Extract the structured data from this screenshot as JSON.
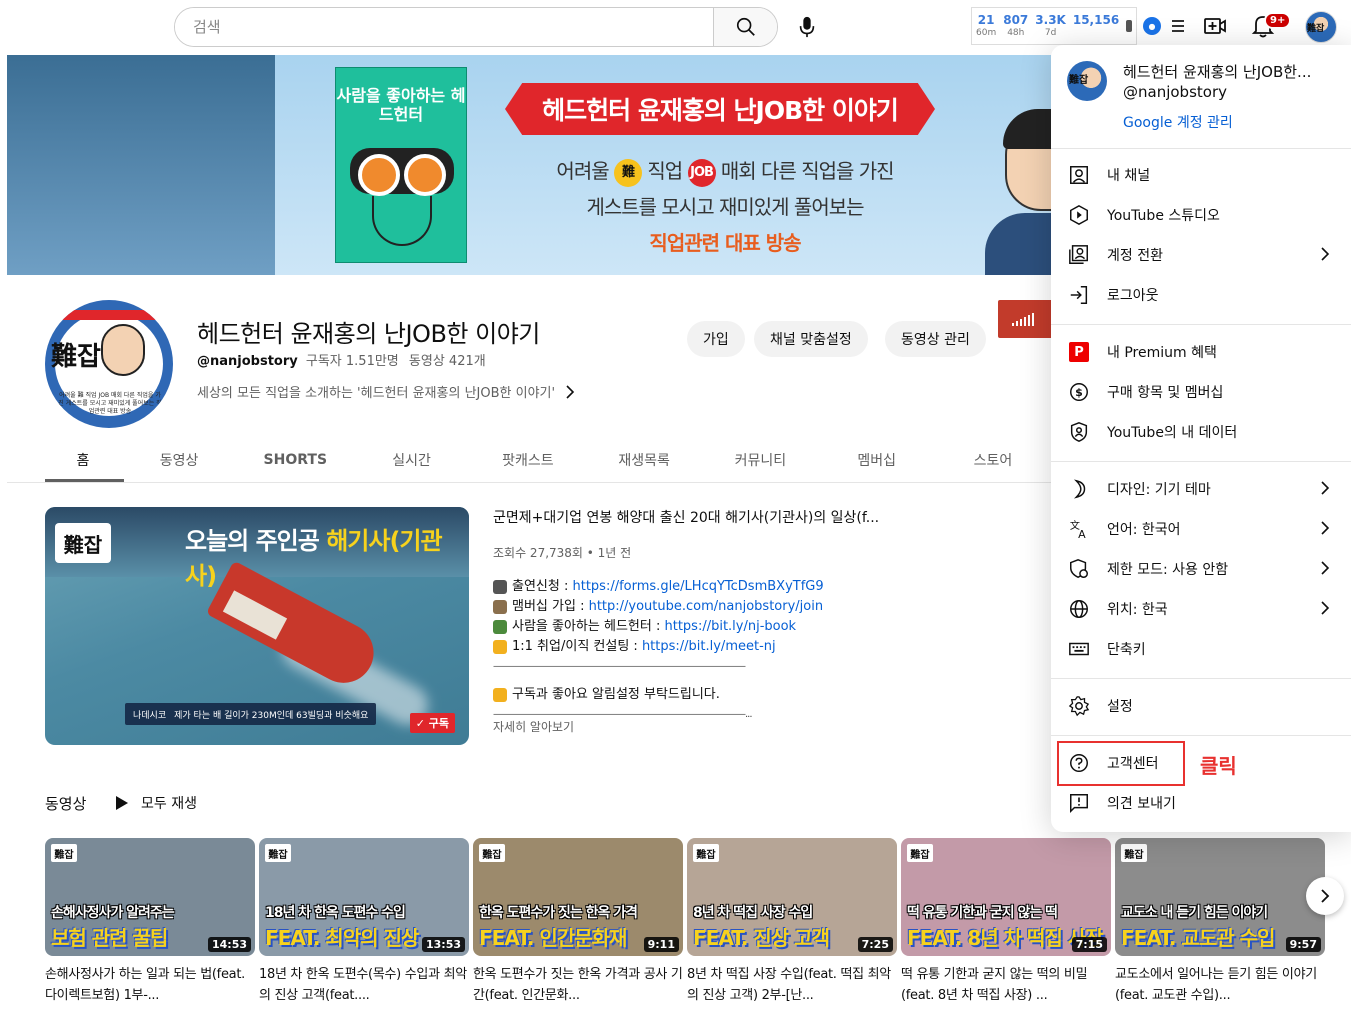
{
  "topbar": {
    "search_placeholder": "검색",
    "stats": [
      {
        "value": "21",
        "label": "60m"
      },
      {
        "value": "807",
        "label": "48h"
      },
      {
        "value": "3.3K",
        "label": "7d"
      },
      {
        "value": "15,156",
        "label": ""
      }
    ],
    "notif_badge": "9+",
    "avatar_text": "難잡"
  },
  "banner": {
    "book_title": "사람을 좋아하는 헤드헌터",
    "headline": "헤드헌터 윤재홍의 난JOB한 이야기",
    "line1_a": "어려울",
    "line1_b": "직업",
    "line1_c": "매회 다른 직업을 가진",
    "circle1": "難",
    "circle2": "JOB",
    "line2": "게스트를 모시고 재미있게 풀어보는",
    "line3": "직업관련 대표 방송"
  },
  "channel": {
    "avatar_big": "難잡",
    "avatar_small": "어려울 難 직업 JOB 매회 다른 직업을 가진 게스트를 모시고 재미있게 풀어보는 직업관련 대표 방송",
    "title": "헤드헌터 윤재홍의 난JOB한 이야기",
    "handle": "@nanjobstory",
    "subs": "구독자 1.51만명",
    "videos": "동영상 421개",
    "description": "세상의 모든 직업을 소개하는 '헤드헌터 윤재홍의 난JOB한 이야기'",
    "btn_join": "가입",
    "btn_customize": "채널 맞춤설정",
    "btn_manage": "동영상 관리"
  },
  "tabs": [
    "홈",
    "동영상",
    "SHORTS",
    "실시간",
    "팟캐스트",
    "재생목록",
    "커뮤니티",
    "멤버십",
    "스토어"
  ],
  "featured": {
    "thumb_logo": "難잡",
    "thumb_title_a": "오늘의 주인공",
    "thumb_title_b": "해기사(기관사)",
    "thumb_caption_a": "나데시코",
    "thumb_caption_b": "제가 타는 배 길이가 230M인데 63빌딩과 비슷해요",
    "thumb_subscribe": "구독",
    "title": "군면제+대기업 연봉 해양대 출신 20대 해기사(기관사)의 일상(f...",
    "meta": "조회수 27,738회 • 1년 전",
    "lines": [
      {
        "text": "출연신청 : ",
        "link": "https://forms.gle/LHcqYTcDsmBXyTfG9",
        "color": "#555555"
      },
      {
        "text": "맴버십 가입 : ",
        "link": "http://youtube.com/nanjobstory/join",
        "color": "#8a6f4d"
      },
      {
        "text": "사람을 좋아하는 헤드헌터 : ",
        "link": "https://bit.ly/nj-book",
        "color": "#4c8a3c"
      },
      {
        "text": "1:1 취업/이직 컨설팅 : ",
        "link": "https://bit.ly/meet-nj",
        "color": "#f2b01e"
      }
    ],
    "rule1": "————————————————————————————",
    "cta": "구독과 좋아요 알림설정 부탁드립니다.",
    "rule2": "————————————————————————————...",
    "more": "자세히 알아보기"
  },
  "shelf": {
    "title": "동영상",
    "play_all": "모두 재생",
    "videos": [
      {
        "t1": "손해사정사가 알려주는",
        "t2": "보험 관련 꿀팁",
        "dur": "14:53",
        "title": "손해사정사가 하는 일과 되는 법(feat. 다이렉트보험) 1부-...",
        "bg": "#7a8a97"
      },
      {
        "t1": "18년 차 한옥 도편수 수입",
        "t2": "FEAT. 최악의 진상",
        "dur": "13:53",
        "title": "18년 차 한옥 도편수(목수) 수입과 최악의 진상 고객(feat....",
        "bg": "#8a9aa8"
      },
      {
        "t1": "한옥 도편수가 짓는 한옥 가격",
        "t2": "FEAT. 인간문화재",
        "dur": "9:11",
        "title": "한옥 도편수가 짓는 한옥 가격과 공사 기간(feat. 인간문화...",
        "bg": "#9c8a6c"
      },
      {
        "t1": "8년 차 떡집 사장 수입",
        "t2": "FEAT. 진상 고객",
        "dur": "7:25",
        "title": "8년 차 떡집 사장 수입(feat. 떡집 최악의 진상 고객) 2부-[난...",
        "bg": "#b6a596"
      },
      {
        "t1": "떡 유통 기한과 굳지 않는 떡",
        "t2": "FEAT. 8년 차 떡집 사장",
        "dur": "7:15",
        "title": "떡 유통 기한과 굳지 않는 떡의 비밀(feat. 8년 차 떡집 사장) ...",
        "bg": "#c39aa8"
      },
      {
        "t1": "교도소 내 듣기 힘든 이야기",
        "t2": "FEAT. 교도관 수입",
        "dur": "9:57",
        "title": "교도소에서 일어나는 듣기 힘든 이야기(feat. 교도관 수입)...",
        "bg": "#8c8c8c"
      }
    ]
  },
  "menu": {
    "name": "헤드헌터 윤재홍의 난JOB한...",
    "handle": "@nanjobstory",
    "manage": "Google 계정 관리",
    "items": [
      {
        "label": "내 채널",
        "icon": "person-box-icon",
        "chevron": false
      },
      {
        "label": "YouTube 스튜디오",
        "icon": "studio-icon",
        "chevron": false
      },
      {
        "label": "계정 전환",
        "icon": "switch-account-icon",
        "chevron": true
      },
      {
        "label": "로그아웃",
        "icon": "sign-out-icon",
        "chevron": false
      },
      {
        "label": "내 Premium 혜택",
        "icon": "premium-icon",
        "chevron": false
      },
      {
        "label": "구매 항목 및 멤버십",
        "icon": "dollar-icon",
        "chevron": false
      },
      {
        "label": "YouTube의 내 데이터",
        "icon": "shield-person-icon",
        "chevron": false
      },
      {
        "label": "디자인: 기기 테마",
        "icon": "moon-icon",
        "chevron": true
      },
      {
        "label": "언어: 한국어",
        "icon": "translate-icon",
        "chevron": true
      },
      {
        "label": "제한 모드: 사용 안함",
        "icon": "restricted-icon",
        "chevron": true
      },
      {
        "label": "위치: 한국",
        "icon": "globe-icon",
        "chevron": true
      },
      {
        "label": "단축키",
        "icon": "keyboard-icon",
        "chevron": false
      },
      {
        "label": "설정",
        "icon": "gear-icon",
        "chevron": false
      },
      {
        "label": "고객센터",
        "icon": "help-icon",
        "chevron": false
      },
      {
        "label": "의견 보내기",
        "icon": "feedback-icon",
        "chevron": false
      }
    ]
  },
  "annotation": {
    "click_note": "클릭",
    "color": "#e8312f"
  }
}
